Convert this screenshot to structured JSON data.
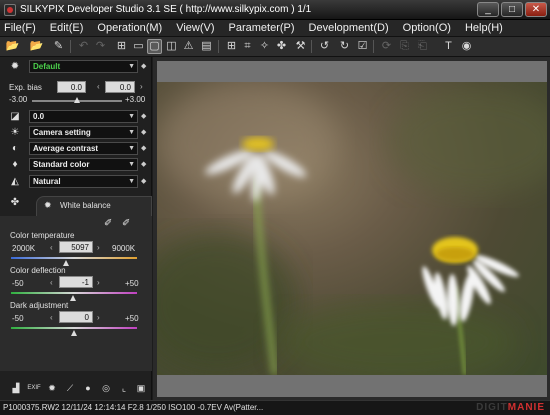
{
  "window": {
    "title": "SILKYPIX Developer Studio 3.1 SE ( http://www.silkypix.com )   1/1",
    "minimize": "_",
    "maximize": "□",
    "close": "✕"
  },
  "menu": [
    "File(F)",
    "Edit(E)",
    "Operation(M)",
    "View(V)",
    "Parameter(P)",
    "Development(D)",
    "Option(O)",
    "Help(H)"
  ],
  "panel": {
    "taste_value": "Default",
    "exp_bias": {
      "label": "Exp. bias",
      "left_value": "0.0",
      "right_value": "0.0",
      "min": "-3.00",
      "max": "+3.00",
      "level": 0.5
    },
    "tone_value": "0.0",
    "camera_setting": "Camera setting",
    "contrast": "Average contrast",
    "color": "Standard color",
    "sharpness": "Natural",
    "white_balance_title": "White balance",
    "color_temperature": {
      "label": "Color temperature",
      "min": "2000K",
      "value": "5097",
      "max": "9000K",
      "level": 0.44
    },
    "color_deflection": {
      "label": "Color deflection",
      "min": "-50",
      "value": "-1",
      "max": "+50",
      "level": 0.49
    },
    "dark_adjustment": {
      "label": "Dark adjustment",
      "min": "-50",
      "value": "0",
      "max": "+50",
      "level": 0.5
    }
  },
  "status": {
    "text": "P1000375.RW2 12/11/24 12:14:14 F2.8 1/250 ISO100 -0.7EV Av(Patter...",
    "watermark_a": "DIGIT",
    "watermark_b": "MANIE"
  },
  "colors": {
    "accent_green": "#4cd04c",
    "background": "#1c1c1c",
    "viewer_frame": "#727272"
  }
}
